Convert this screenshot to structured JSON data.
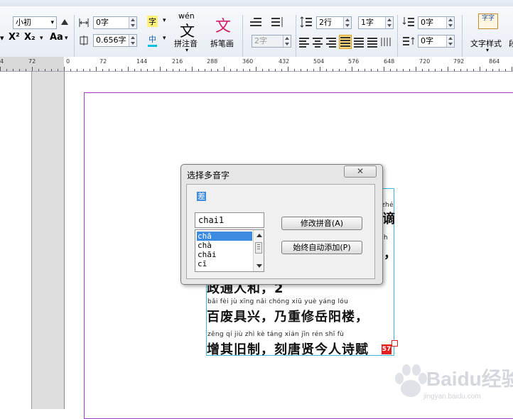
{
  "ribbon": {
    "font_size_value": "小初",
    "font_style_label": "Aa",
    "superscript_label": "X²",
    "subscript_label": "X₂",
    "char_spacing_value": "0字",
    "char_width_value": "0.656字",
    "zi_label": "字",
    "zhong_label": "中",
    "pinyin_top": "wén",
    "pinyin_char": "文",
    "pinyin_button_label": "拼注音",
    "stroke_char": "文",
    "stroke_button_label": "拆笔画",
    "indent_value": "2字",
    "line_spacing_value": "2行",
    "para_spacing_value": "1字",
    "space_before_value": "0字",
    "space_after_value": "0字",
    "text_style_icon_label": "字字",
    "text_style_label": "文字样式",
    "text_style_extra": "段"
  },
  "ruler": {
    "labels": [
      "4",
      "72",
      "0",
      "72",
      "144",
      "216",
      "288",
      "360",
      "432",
      "504",
      "576",
      "648",
      "720",
      "792",
      "864"
    ]
  },
  "text": {
    "pinyin_line_1": "zhé",
    "hanzi_line_1_tail": "谪",
    "hanzi_line_2_tail": "，",
    "pinyin_line_2_tail": "h",
    "hanzi_line_3": "政通人和，2",
    "pinyin_line_4": "bǎi   fèi   jù   xīng      nǎi chóng xiū   yuè yáng  lóu",
    "hanzi_line_4": "百废具兴，乃重修岳阳楼，",
    "pinyin_line_5": "zēng  qí   jiù   zhì       kè táng xián  jīn   rén  shī   fù",
    "hanzi_line_5": "增其旧制，刻唐贤今人诗赋",
    "overflow_badge": "57"
  },
  "dialog": {
    "title": "选择多音字",
    "close_label": "✕",
    "selected_char": "差",
    "pinyin_input": "chai1",
    "options": [
      "chā",
      "chà",
      "chāi",
      "cī"
    ],
    "selected_index": 0,
    "modify_button": "修改拼音(A)",
    "auto_add_button": "始终自动添加(P)"
  },
  "watermark": {
    "text": "Baidu经验",
    "url": "jingyan.baidu.com"
  }
}
